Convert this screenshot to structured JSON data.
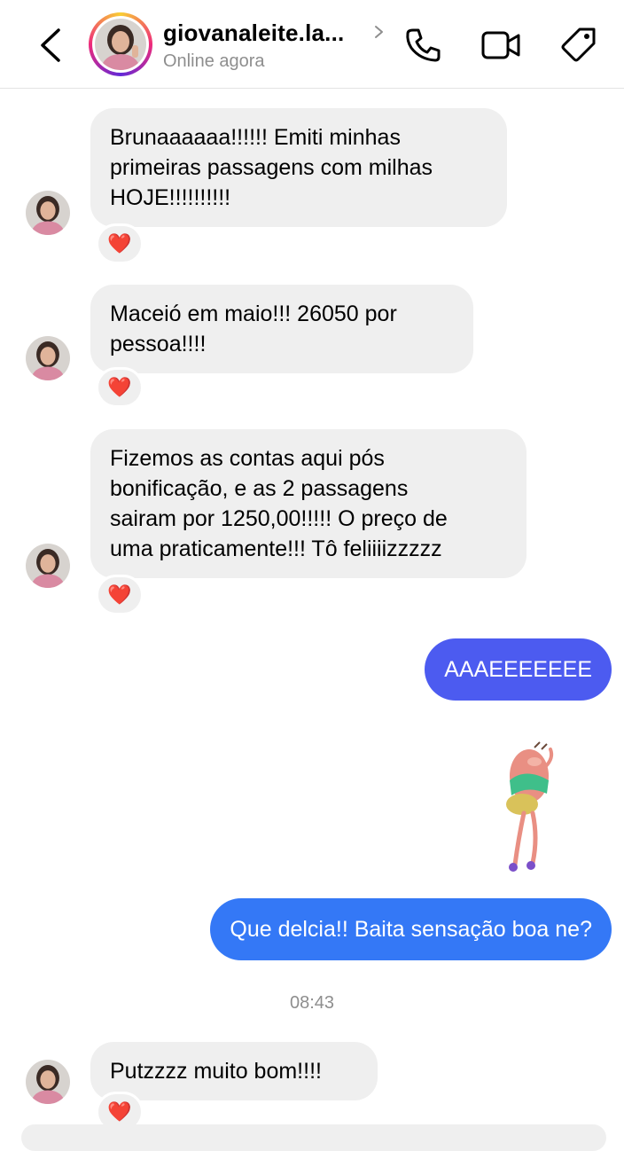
{
  "header": {
    "name": "giovanaleite.la...",
    "status": "Online agora"
  },
  "messages": [
    {
      "side": "in",
      "text": "Brunaaaaaa!!!!!! Emiti minhas\nprimeiras passagens com milhas\nHOJE!!!!!!!!!!",
      "reaction": "❤️"
    },
    {
      "side": "in",
      "text": "Maceió em maio!!! 26050 por\npessoa!!!!",
      "reaction": "❤️"
    },
    {
      "side": "in",
      "text": "Fizemos as contas aqui pós\nbonificação, e as 2 passagens\nsairam por 1250,00!!!!! O preço de\numa praticamente!!! Tô feliiiizzzzz",
      "reaction": "❤️"
    },
    {
      "side": "out",
      "text": "AAAEEEEEEE"
    },
    {
      "side": "out",
      "type": "sticker",
      "sticker": "dancing-character-sticker"
    },
    {
      "side": "out",
      "text": "Que delcia!! Baita sensação boa ne?"
    },
    {
      "side": "in",
      "text": "Putzzzz muito bom!!!!",
      "reaction": "❤️"
    }
  ],
  "timestamp": "08:43",
  "colors": {
    "incoming_bubble": "#efefef",
    "outgoing_bubble_purple": "#4c5bf0",
    "outgoing_bubble_blue": "#3478f6",
    "secondary_text": "#8e8e8e"
  }
}
